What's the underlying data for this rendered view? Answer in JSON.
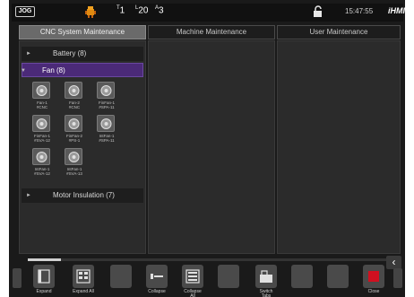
{
  "status": {
    "mode": "JOG",
    "indicators": [
      {
        "num": "1",
        "sup": "T"
      },
      {
        "num": "20",
        "sup": "L"
      },
      {
        "num": "3",
        "sup": "A"
      }
    ],
    "time": "15:47:55",
    "brand": "iHMI"
  },
  "tabs": [
    {
      "label": "CNC System Maintenance"
    },
    {
      "label": "Machine Maintenance"
    },
    {
      "label": "User Maintenance"
    }
  ],
  "tree": {
    "battery": "Battery (8)",
    "fan": "Fan (8)",
    "motor": "Motor Insulation (7)"
  },
  "fans": [
    {
      "label": "Fan-1\n#CNC"
    },
    {
      "label": "Fan-2\n#CNC"
    },
    {
      "label": "FinFan-1\n#SPA-11"
    },
    {
      "label": "FinFan-1\n#SVA-12"
    },
    {
      "label": "FinFan-2\n#PS-1"
    },
    {
      "label": "IntFan-1\n#SPA-11"
    },
    {
      "label": "IntFan-1\n#SVA-12"
    },
    {
      "label": "IntFan-1\n#SVA-13"
    }
  ],
  "softkeys": {
    "expand": "Expand",
    "expand_all": "Expand All",
    "collapse": "Collapse",
    "collapse_all": "Collapse\nAll",
    "switch_tabs": "Switch\nTabs",
    "close": "Close"
  },
  "page_progress": 0.09,
  "colors": {
    "selected_row": "#4b2a78",
    "close_accent": "#d01020",
    "active_tab": "#6a6a6a"
  }
}
